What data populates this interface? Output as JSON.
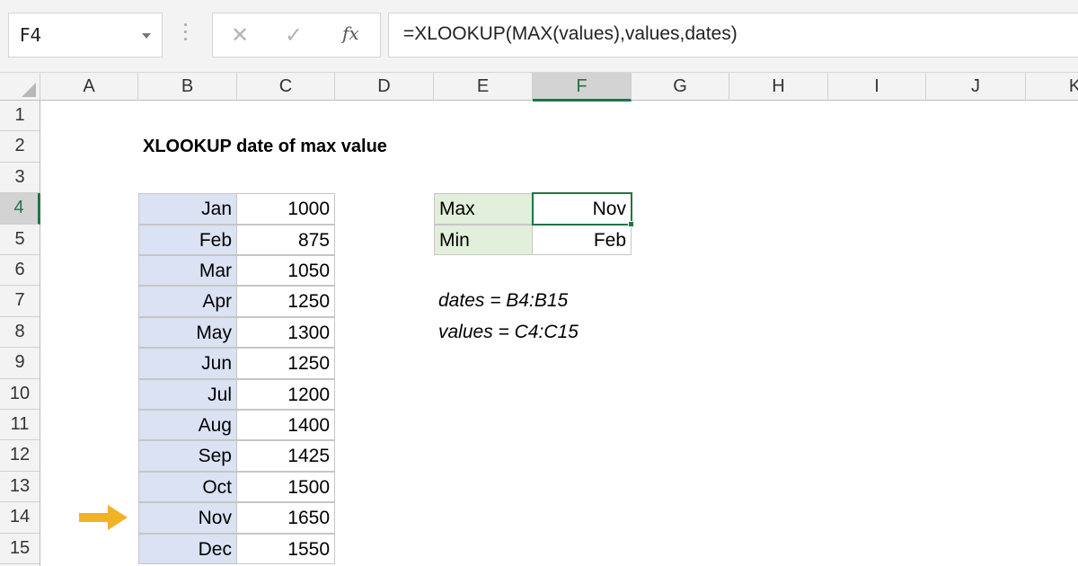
{
  "formula_bar": {
    "name_box": "F4",
    "formula": "=XLOOKUP(MAX(values),values,dates)",
    "icons": [
      "cancel-icon",
      "enter-icon",
      "fx-icon"
    ]
  },
  "columns": [
    "A",
    "B",
    "C",
    "D",
    "E",
    "F",
    "G",
    "H",
    "I",
    "J",
    "K"
  ],
  "active_column": "F",
  "rows": [
    "1",
    "2",
    "3",
    "4",
    "5",
    "6",
    "7",
    "8",
    "9",
    "10",
    "11",
    "12",
    "13",
    "14",
    "15"
  ],
  "active_row": "4",
  "title": "XLOOKUP date of max value",
  "table": [
    {
      "month": "Jan",
      "value": "1000"
    },
    {
      "month": "Feb",
      "value": "875"
    },
    {
      "month": "Mar",
      "value": "1050"
    },
    {
      "month": "Apr",
      "value": "1250"
    },
    {
      "month": "May",
      "value": "1300"
    },
    {
      "month": "Jun",
      "value": "1250"
    },
    {
      "month": "Jul",
      "value": "1200"
    },
    {
      "month": "Aug",
      "value": "1400"
    },
    {
      "month": "Sep",
      "value": "1425"
    },
    {
      "month": "Oct",
      "value": "1500"
    },
    {
      "month": "Nov",
      "value": "1650"
    },
    {
      "month": "Dec",
      "value": "1550"
    }
  ],
  "summary": [
    {
      "label": "Max",
      "result": "Nov"
    },
    {
      "label": "Min",
      "result": "Feb"
    }
  ],
  "named_ranges": [
    "dates = B4:B15",
    "values = C4:C15"
  ],
  "colors": {
    "accent_green": "#217346",
    "month_fill": "#dae2f3",
    "label_fill": "#e2efda",
    "arrow": "#f0b323"
  }
}
